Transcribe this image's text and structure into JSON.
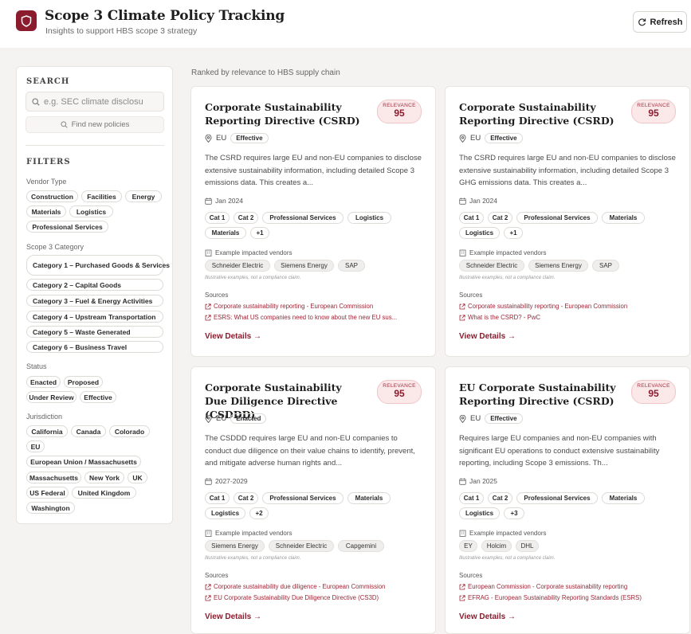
{
  "header": {
    "title": "Scope 3 Climate Policy Tracking",
    "subtitle": "Insights to support HBS scope 3 strategy",
    "refresh_label": "Refresh",
    "brand_color": "#8b1c2e"
  },
  "sidebar": {
    "search_title": "SEARCH",
    "search_placeholder": "e.g. SEC climate disclosu",
    "find_label": "Find new policies",
    "filters_title": "FILTERS",
    "vendor_type_label": "Vendor Type",
    "vendor_types": [
      "Construction",
      "Facilities",
      "Energy",
      "Materials",
      "Logistics",
      "Professional Services"
    ],
    "scope_label": "Scope 3 Category",
    "scope_categories": [
      "Category 1 – Purchased Goods & Services",
      "Category 2 – Capital Goods",
      "Category 3 – Fuel & Energy Activities",
      "Category 4 – Upstream Transportation",
      "Category 5 – Waste Generated",
      "Category 6 – Business Travel"
    ],
    "status_label": "Status",
    "statuses": [
      "Enacted",
      "Proposed",
      "Under Review",
      "Effective"
    ],
    "jurisdiction_label": "Jurisdiction",
    "jurisdictions": [
      "California",
      "Canada",
      "Colorado",
      "EU",
      "European Union / Massachusetts",
      "Massachusetts",
      "New York",
      "UK",
      "US Federal",
      "United Kingdom",
      "Washington"
    ]
  },
  "main": {
    "ranked_label": "Ranked by relevance to HBS supply chain",
    "relevance_label": "RELEVANCE",
    "vendors_label": "Example impacted vendors",
    "disclaimer": "Illustrative examples, not a compliance claim.",
    "sources_label": "Sources",
    "view_label": "View Details →",
    "cards": [
      {
        "title": "Corporate Sustainability Reporting Directive (CSRD)",
        "relevance": "95",
        "jurisdiction": "EU",
        "status": "Effective",
        "description": "The CSRD requires large EU and non-EU companies to disclose extensive sustainability information, including detailed Scope 3 emissions data. This creates a...",
        "date": "Jan 2024",
        "tags": [
          "Cat 1",
          "Cat 2",
          "Professional Services",
          "Logistics",
          "Materials",
          "+1"
        ],
        "vendors": [
          "Schneider Electric",
          "Siemens Energy",
          "SAP"
        ],
        "sources": [
          "Corporate sustainability reporting - European Commission",
          "ESRS: What US companies need to know about the new EU sus..."
        ]
      },
      {
        "title": "Corporate Sustainability Reporting Directive (CSRD)",
        "relevance": "95",
        "jurisdiction": "EU",
        "status": "Effective",
        "description": "The CSRD requires large EU and non-EU companies to disclose extensive sustainability information, including detailed Scope 3 GHG emissions data. This creates a...",
        "date": "Jan 2024",
        "tags": [
          "Cat 1",
          "Cat 2",
          "Professional Services",
          "Materials",
          "Logistics",
          "+1"
        ],
        "vendors": [
          "Schneider Electric",
          "Siemens Energy",
          "SAP"
        ],
        "sources": [
          "Corporate sustainability reporting - European Commission",
          "What is the CSRD? - PwC"
        ]
      },
      {
        "title": "Corporate Sustainability Due Diligence Directive (CSDDD)",
        "relevance": "95",
        "jurisdiction": "EU",
        "status": "Enacted",
        "description": "The CSDDD requires large EU and non-EU companies to conduct due diligence on their value chains to identify, prevent, and mitigate adverse human rights and...",
        "date": "2027-2029",
        "tags": [
          "Cat 1",
          "Cat 2",
          "Professional Services",
          "Materials",
          "Logistics",
          "+2"
        ],
        "vendors": [
          "Siemens Energy",
          "Schneider Electric",
          "Capgemini"
        ],
        "sources": [
          "Corporate sustainability due diligence - European Commission",
          "EU Corporate Sustainability Due Diligence Directive (CS3D)"
        ]
      },
      {
        "title": "EU Corporate Sustainability Reporting Directive (CSRD)",
        "relevance": "95",
        "jurisdiction": "EU",
        "status": "Effective",
        "description": "Requires large EU companies and non-EU companies with significant EU operations to conduct extensive sustainability reporting, including Scope 3 emissions. Th...",
        "date": "Jan 2025",
        "tags": [
          "Cat 1",
          "Cat 2",
          "Professional Services",
          "Materials",
          "Logistics",
          "+3"
        ],
        "vendors": [
          "EY",
          "Holcim",
          "DHL"
        ],
        "sources": [
          "European Commission - Corporate sustainability reporting",
          "EFRAG - European Sustainability Reporting Standards (ESRS)"
        ]
      }
    ]
  }
}
